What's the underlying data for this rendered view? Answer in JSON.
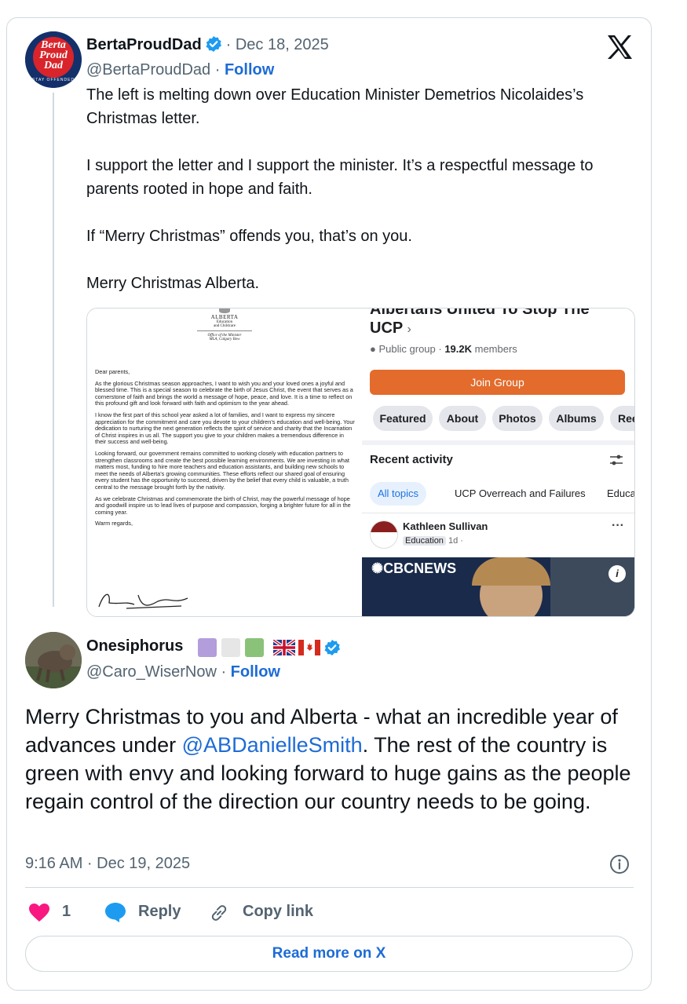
{
  "app": "X",
  "original_post": {
    "display_name": "BertaProudDad",
    "date": "Dec 18, 2025",
    "handle": "@BertaProudDad",
    "follow_label": "Follow",
    "avatar_text": [
      "Berta",
      "Proud",
      "Dad"
    ],
    "avatar_ring_text": "STAY OFFENDED",
    "paragraphs": [
      "The left is melting down over Education Minister Demetrios Nicolaides’s Christmas letter.",
      "I support the letter and I support the minister. It’s a respectful message to parents rooted in hope and faith.",
      "If “Merry Christmas” offends you, that’s on you.",
      "Merry Christmas Alberta."
    ],
    "letter": {
      "header": [
        "ALBERTA",
        "Education",
        "and Childcare"
      ],
      "office": [
        "Office of the Minister",
        "MLA, Calgary Bow"
      ],
      "greeting": "Dear parents,",
      "paragraphs": [
        "As the glorious Christmas season approaches, I want to wish you and your loved ones a joyful and blessed time. This is a special season to celebrate the birth of Jesus Christ, the event that serves as a cornerstone of faith and brings the world a message of hope, peace, and love. It is a time to reflect on this profound gift and look forward with faith and optimism to the year ahead.",
        "I know the first part of this school year asked a lot of families, and I want to express my sincere appreciation for the commitment and care you devote to your children’s education and well-being. Your dedication to nurturing the next generation reflects the spirit of service and charity that the Incarnation of Christ inspires in us all. The support you give to your children makes a tremendous difference in their success and well-being.",
        "Looking forward, our government remains committed to working closely with education partners to strengthen classrooms and create the best possible learning environments. We are investing in what matters most, funding to hire more teachers and education assistants, and building new schools to meet the needs of Alberta’s growing communities. These efforts reflect our shared goal of ensuring every student has the opportunity to succeed, driven by the belief that every child is valuable, a truth central to the message brought forth by the nativity.",
        "As we celebrate Christmas and commemorate the birth of Christ, may the powerful message of hope and goodwill inspire us to lead lives of purpose and compassion, forging a brighter future for all in the coming year."
      ],
      "closing": "Warm regards,"
    },
    "facebook": {
      "group_name_top": "Albertans United To Stop The",
      "group_name": "UCP",
      "group_meta_prefix": "Public group · ",
      "members_count": "19.2K",
      "members_label": " members",
      "join_label": "Join Group",
      "tabs": [
        "Featured",
        "About",
        "Photos",
        "Albums",
        "Ree"
      ],
      "recent_activity": "Recent activity",
      "topics": [
        "All topics",
        "UCP Overreach and Failures",
        "Educa"
      ],
      "post_author": "Kathleen Sullivan",
      "post_tag": "Education",
      "post_time": "1d ·",
      "news_label": "CBCNEWS",
      "more_dots": "···"
    }
  },
  "reply_post": {
    "display_name": "Onesiphorus",
    "handle": "@Caro_WiserNow",
    "follow_label": "Follow",
    "name_squares": [
      "#b39ddb",
      "#e6e6e6",
      "#8bc27a"
    ],
    "text_before": "Merry Christmas to you and Alberta - what an incredible year of advances under ",
    "mention": "@ABDanielleSmith",
    "text_after": ". The rest of the country is green with envy and looking forward to huge gains as the people regain control of the direction our country needs to be going.",
    "timestamp": "9:16 AM · Dec 19, 2025"
  },
  "actions": {
    "like_count": "1",
    "reply_label": "Reply",
    "copy_link_label": "Copy link"
  },
  "footer": {
    "read_more_label": "Read more on X"
  },
  "colors": {
    "accent": "#1d6bd6",
    "verified": "#1d9bf0",
    "like": "#f91880",
    "join_button": "#e36b2c"
  }
}
